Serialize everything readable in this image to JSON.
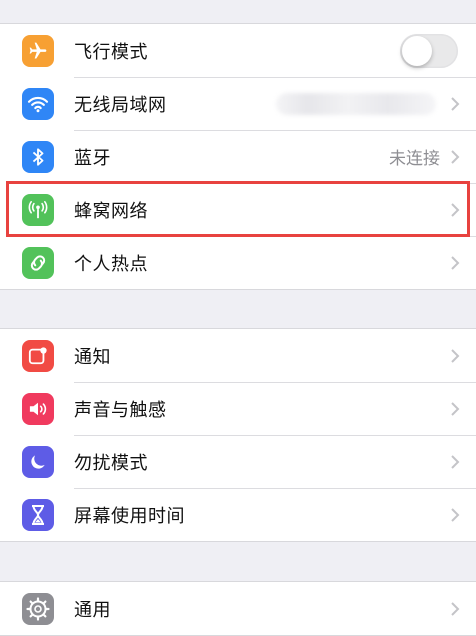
{
  "settings": {
    "group1": [
      {
        "label": "飞行模式",
        "icon": "airplane-icon",
        "color": "#f7a033",
        "control": "toggle",
        "toggle_on": false
      },
      {
        "label": "无线局域网",
        "icon": "wifi-icon",
        "color": "#2f86f6",
        "control": "chevron",
        "value": ""
      },
      {
        "label": "蓝牙",
        "icon": "bluetooth-icon",
        "color": "#2f86f6",
        "control": "chevron",
        "value": "未连接"
      },
      {
        "label": "蜂窝网络",
        "icon": "cellular-antenna-icon",
        "color": "#52c25a",
        "control": "chevron",
        "highlighted": true
      },
      {
        "label": "个人热点",
        "icon": "hotspot-icon",
        "color": "#52c25a",
        "control": "chevron"
      }
    ],
    "group2": [
      {
        "label": "通知",
        "icon": "notifications-icon",
        "color": "#f14b44"
      },
      {
        "label": "声音与触感",
        "icon": "speaker-icon",
        "color": "#f03a5e"
      },
      {
        "label": "勿扰模式",
        "icon": "moon-icon",
        "color": "#5e5ce6"
      },
      {
        "label": "屏幕使用时间",
        "icon": "hourglass-icon",
        "color": "#5e5ce6"
      }
    ],
    "group3": [
      {
        "label": "通用",
        "icon": "gear-icon",
        "color": "#8e8e93"
      }
    ]
  },
  "highlight_color": "#e8423f"
}
